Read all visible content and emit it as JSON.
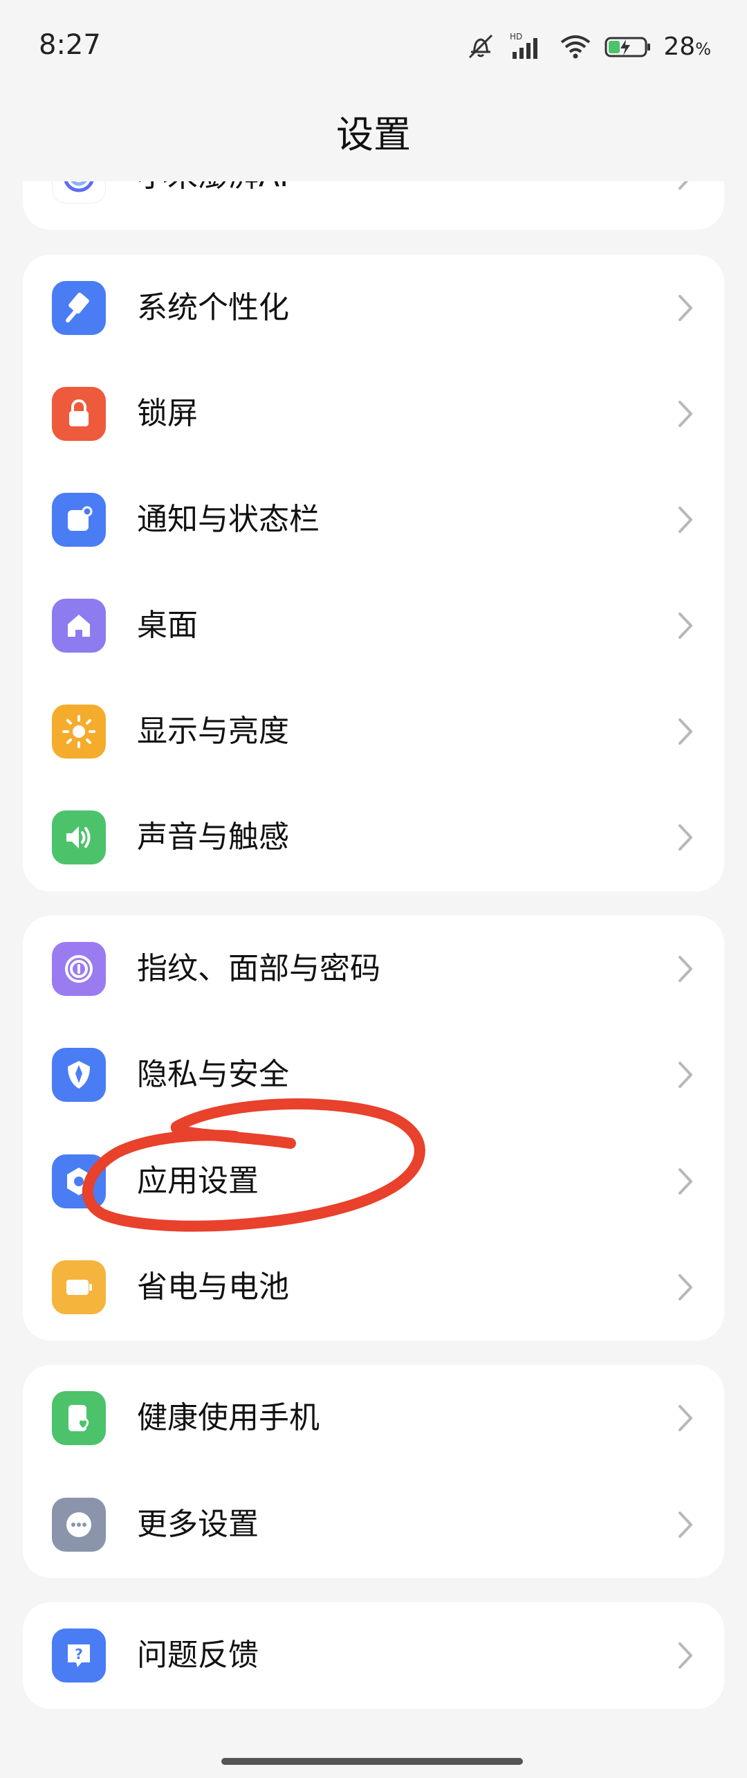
{
  "status_bar": {
    "time": "8:27",
    "battery_percent": "28",
    "battery_unit": "%",
    "network_label": "HD",
    "icons": [
      "muted-bell-icon",
      "signal-icon",
      "wifi-icon",
      "battery-charging-icon"
    ]
  },
  "header": {
    "title": "设置"
  },
  "cards": [
    {
      "items": [
        {
          "label": "小米澎湃AI",
          "icon": "ai-swirl-icon",
          "color": "#5b6df5"
        }
      ]
    },
    {
      "items": [
        {
          "label": "系统个性化",
          "icon": "brush-icon",
          "color": "#4a7cf4"
        },
        {
          "label": "锁屏",
          "icon": "lock-icon",
          "color": "#ee5a3c"
        },
        {
          "label": "通知与状态栏",
          "icon": "notification-icon",
          "color": "#4a7cf4"
        },
        {
          "label": "桌面",
          "icon": "home-icon",
          "color": "#8c7cf0"
        },
        {
          "label": "显示与亮度",
          "icon": "sun-icon",
          "color": "#f5ac2c"
        },
        {
          "label": "声音与触感",
          "icon": "speaker-icon",
          "color": "#4cc36a"
        }
      ]
    },
    {
      "items": [
        {
          "label": "指纹、面部与密码",
          "icon": "fingerprint-icon",
          "color": "#9a7cf0"
        },
        {
          "label": "隐私与安全",
          "icon": "shield-icon",
          "color": "#4a7cf4"
        },
        {
          "label": "应用设置",
          "icon": "app-settings-icon",
          "color": "#4a7cf4"
        },
        {
          "label": "省电与电池",
          "icon": "battery-icon",
          "color": "#f5b43c"
        }
      ]
    },
    {
      "items": [
        {
          "label": "健康使用手机",
          "icon": "health-heart-icon",
          "color": "#4cc36a"
        },
        {
          "label": "更多设置",
          "icon": "more-dots-icon",
          "color": "#8a94ab"
        }
      ]
    },
    {
      "items": [
        {
          "label": "问题反馈",
          "icon": "feedback-icon",
          "color": "#4a7cf4"
        }
      ]
    }
  ],
  "colors": {
    "annotation_red": "#e8412c",
    "chevron": "#b8b8b8",
    "background": "#f5f5f5"
  }
}
